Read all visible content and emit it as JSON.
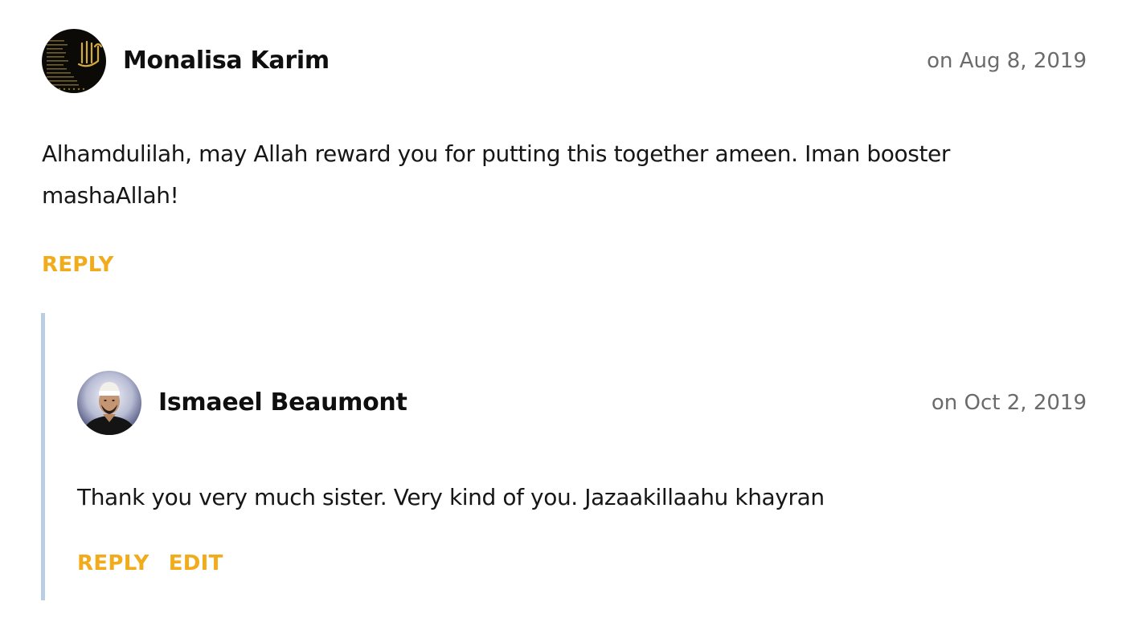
{
  "comments": [
    {
      "author": "Monalisa Karim",
      "date": "on Aug 8, 2019",
      "body": "Alhamdulilah, may Allah reward you for putting this together ameen. Iman booster mashaAllah!",
      "actions": {
        "reply": "REPLY"
      }
    },
    {
      "author": "Ismaeel Beaumont",
      "date": "on Oct 2, 2019",
      "body": "Thank you very much sister. Very kind of you. Jazaakillaahu khayran",
      "actions": {
        "reply": "REPLY",
        "edit": "EDIT"
      }
    }
  ],
  "colors": {
    "action": "#f1ab1b",
    "date": "#6b6b6b",
    "reply_border": "#b9cfe1"
  }
}
